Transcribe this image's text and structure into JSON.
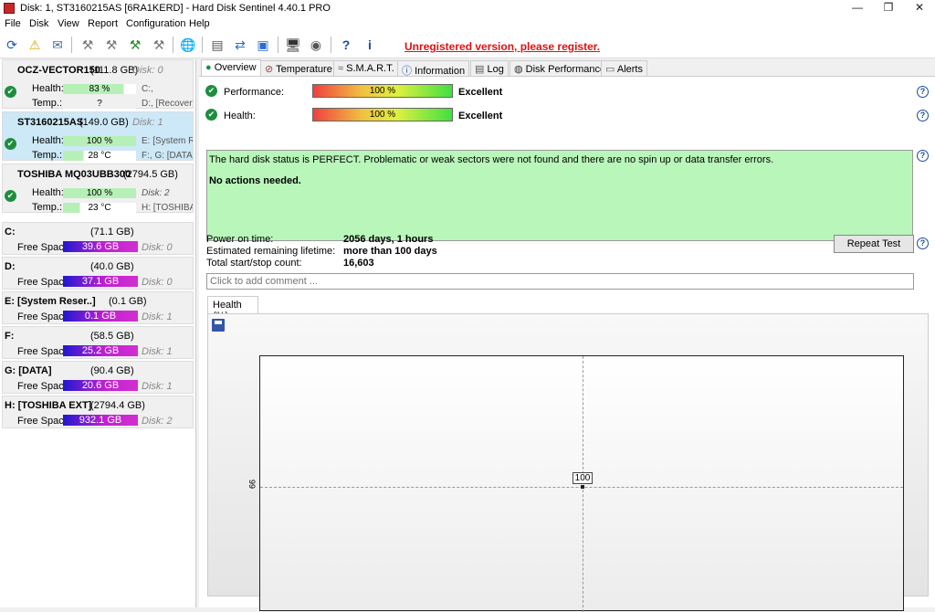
{
  "window": {
    "title": "Disk: 1, ST3160215AS [6RA1KERD]  -  Hard Disk Sentinel 4.40.1 PRO",
    "min": "—",
    "max": "❐",
    "close": "✕"
  },
  "menu": [
    "File",
    "Disk",
    "View",
    "Report",
    "Configuration",
    "Help"
  ],
  "toolbar": {
    "unregistered": "Unregistered version, please register."
  },
  "disks": [
    {
      "name": "OCZ-VECTOR150",
      "size": "(111.8 GB)",
      "disk": "Disk: 0",
      "health_label": "Health:",
      "health": "83 %",
      "health_frac": 0.83,
      "temp_label": "Temp.:",
      "temp": "?",
      "vol1": "C:,",
      "vol2": "D:, [Recovery"
    },
    {
      "name": "ST3160215AS",
      "size": "(149.0 GB)",
      "disk": "Disk: 1",
      "health_label": "Health:",
      "health": "100 %",
      "health_frac": 1.0,
      "temp_label": "Temp.:",
      "temp": "28 °C",
      "vol1": "E: [System Re",
      "vol2": "F:, G: [DATA]"
    },
    {
      "name": "TOSHIBA MQ03UBB300",
      "size": "(2794.5 GB)",
      "disk": "Disk: 2",
      "health_label": "Health:",
      "health": "100 %",
      "health_frac": 1.0,
      "temp_label": "Temp.:",
      "temp": "23 °C",
      "vol1": "Disk: 2",
      "vol2": "H: [TOSHIBA I"
    }
  ],
  "volumes": [
    {
      "name": "C:",
      "size": "(71.1 GB)",
      "free_label": "Free Space",
      "free": "39.6 GB",
      "disk": "Disk: 0"
    },
    {
      "name": "D:",
      "size": "(40.0 GB)",
      "free_label": "Free Space",
      "free": "37.1 GB",
      "disk": "Disk: 0"
    },
    {
      "name": "E: [System Reser..]",
      "size": "(0.1 GB)",
      "free_label": "Free Space",
      "free": "0.1 GB",
      "disk": "Disk: 1"
    },
    {
      "name": "F:",
      "size": "(58.5 GB)",
      "free_label": "Free Space",
      "free": "25.2 GB",
      "disk": "Disk: 1"
    },
    {
      "name": "G: [DATA]",
      "size": "(90.4 GB)",
      "free_label": "Free Space",
      "free": "20.6 GB",
      "disk": "Disk: 1"
    },
    {
      "name": "H: [TOSHIBA EXT]",
      "size": "(2794.4 GB)",
      "free_label": "Free Space",
      "free": "932.1 GB",
      "disk": "Disk: 2"
    }
  ],
  "tabs": [
    "Overview",
    "Temperature",
    "S.M.A.R.T.",
    "Information",
    "Log",
    "Disk Performance",
    "Alerts"
  ],
  "overview": {
    "performance_label": "Performance:",
    "performance_value": "100 %",
    "performance_text": "Excellent",
    "health_label": "Health:",
    "health_value": "100 %",
    "health_text": "Excellent",
    "status_line1": "The hard disk status is PERFECT. Problematic or weak sectors were not found and there are no spin up or data transfer errors.",
    "status_line2": "No actions needed.",
    "power_on_label": "Power on time:",
    "power_on_value": "2056 days, 1 hours",
    "lifetime_label": "Estimated remaining lifetime:",
    "lifetime_value": "more than 100 days",
    "startstop_label": "Total start/stop count:",
    "startstop_value": "16,603",
    "repeat_test": "Repeat Test",
    "comment_placeholder": "Click to add comment ...",
    "graph_tab": "Health (%)"
  },
  "chart_data": {
    "type": "line",
    "y_tick": "99",
    "values": [
      100
    ],
    "point_label": "100"
  }
}
